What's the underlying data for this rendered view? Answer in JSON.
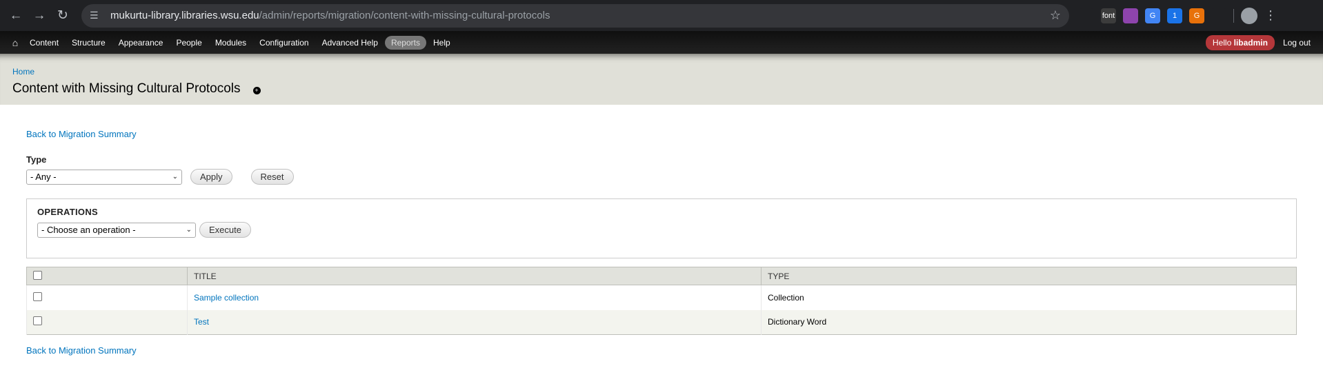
{
  "browser": {
    "url_host": "mukurtu-library.libraries.wsu.edu",
    "url_path": "/admin/reports/migration/content-with-missing-cultural-protocols",
    "extensions": [
      {
        "name": "eyedropper-icon",
        "label": "",
        "color": "#202124"
      },
      {
        "name": "font-icon",
        "label": "font",
        "color": "#3c3c3c"
      },
      {
        "name": "color-wheel-icon",
        "label": "",
        "color": "#8e44ad"
      },
      {
        "name": "google-icon",
        "label": "G",
        "color": "#4285f4"
      },
      {
        "name": "password-manager-icon",
        "label": "1",
        "color": "#1a73e8"
      },
      {
        "name": "g-extension-icon",
        "label": "G",
        "color": "#e8710a"
      },
      {
        "name": "puzzle-icon",
        "label": "",
        "color": "#202124"
      }
    ]
  },
  "toolbar": {
    "items": [
      {
        "label": "Content",
        "active": false
      },
      {
        "label": "Structure",
        "active": false
      },
      {
        "label": "Appearance",
        "active": false
      },
      {
        "label": "People",
        "active": false
      },
      {
        "label": "Modules",
        "active": false
      },
      {
        "label": "Configuration",
        "active": false
      },
      {
        "label": "Advanced Help",
        "active": false
      },
      {
        "label": "Reports",
        "active": true
      },
      {
        "label": "Help",
        "active": false
      }
    ],
    "hello_prefix": "Hello ",
    "username": "libadmin",
    "logout": "Log out"
  },
  "header": {
    "breadcrumb": "Home",
    "title": "Content with Missing Cultural Protocols"
  },
  "content": {
    "back_link": "Back to Migration Summary",
    "filter": {
      "label": "Type",
      "selected": "- Any -",
      "apply": "Apply",
      "reset": "Reset"
    },
    "operations": {
      "title": "OPERATIONS",
      "selected": "- Choose an operation -",
      "execute": "Execute"
    },
    "table": {
      "columns": [
        "TITLE",
        "TYPE"
      ],
      "rows": [
        {
          "title": "Sample collection",
          "type": "Collection"
        },
        {
          "title": "Test",
          "type": "Dictionary Word"
        }
      ]
    }
  }
}
